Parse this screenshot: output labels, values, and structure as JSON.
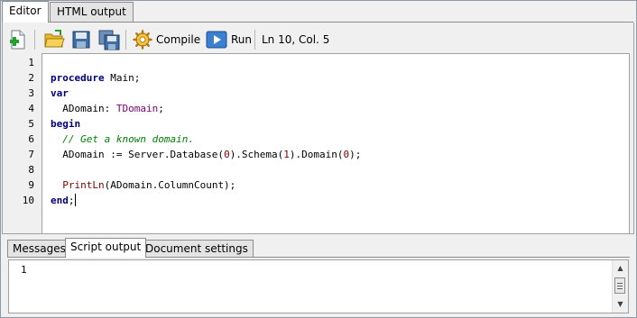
{
  "tabs": {
    "editor": "Editor",
    "html_output": "HTML output"
  },
  "toolbar": {
    "compile_label": "Compile",
    "run_label": "Run",
    "status": "Ln 10, Col. 5"
  },
  "editor": {
    "line_numbers": [
      "1",
      "2",
      "3",
      "4",
      "5",
      "6",
      "7",
      "8",
      "9",
      "10"
    ],
    "code_lines": [
      "",
      "procedure Main;",
      "var",
      "  ADomain: TDomain;",
      "begin",
      "  // Get a known domain.",
      "  ADomain := Server.Database(0).Schema(1).Domain(0);",
      "",
      "  PrintLn(ADomain.ColumnCount);",
      "end;"
    ]
  },
  "bottom_tabs": {
    "messages": "Messages",
    "script_output": "Script output",
    "document_settings": "Document settings"
  },
  "output": {
    "text": "1"
  }
}
